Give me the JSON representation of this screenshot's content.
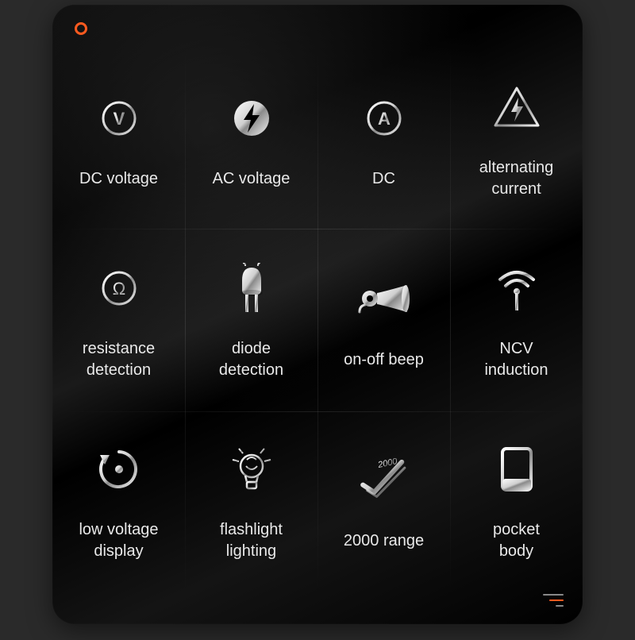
{
  "features": [
    {
      "icon": "voltmeter-v-icon",
      "label": "DC voltage"
    },
    {
      "icon": "ac-bolt-icon",
      "label": "AC voltage"
    },
    {
      "icon": "ammeter-a-icon",
      "label": "DC"
    },
    {
      "icon": "ac-warning-icon",
      "label": "alternating\ncurrent"
    },
    {
      "icon": "ohm-icon",
      "label": "resistance\ndetection"
    },
    {
      "icon": "diode-icon",
      "label": "diode\ndetection"
    },
    {
      "icon": "horn-icon",
      "label": "on-off beep"
    },
    {
      "icon": "ncv-signal-icon",
      "label": "NCV\ninduction"
    },
    {
      "icon": "low-voltage-icon",
      "label": "low voltage\ndisplay"
    },
    {
      "icon": "flashlight-icon",
      "label": "flashlight\nlighting"
    },
    {
      "icon": "range-2000-icon",
      "label": "2000 range"
    },
    {
      "icon": "pocket-body-icon",
      "label": "pocket\nbody"
    }
  ]
}
